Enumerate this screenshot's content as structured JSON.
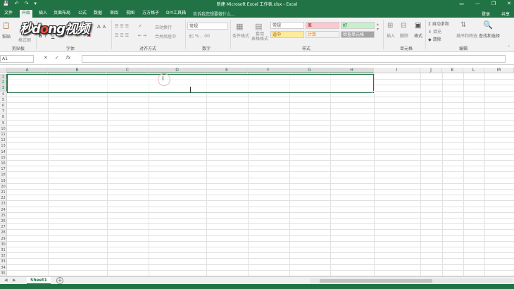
{
  "window": {
    "title": "新建 Microsoft Excel 工作表.xlsx - Excel",
    "quick_access": [
      "💾",
      "↶",
      "↷",
      "▾"
    ],
    "controls": {
      "restore": "▭",
      "minimize": "—",
      "maximize": "❐",
      "close": "✕"
    }
  },
  "tabs": [
    {
      "label": "文件"
    },
    {
      "label": "开始"
    },
    {
      "label": "插入"
    },
    {
      "label": "页面布局"
    },
    {
      "label": "公式"
    },
    {
      "label": "数据"
    },
    {
      "label": "审阅"
    },
    {
      "label": "视图"
    },
    {
      "label": "方方格子"
    },
    {
      "label": "DIY工具箱"
    }
  ],
  "tell_me": "告诉我您想要做什么...",
  "account": {
    "signin": "登录",
    "share": "共享"
  },
  "ribbon": {
    "clipboard": {
      "paste": "粘贴",
      "format_painter": "格式刷",
      "label": "剪贴板"
    },
    "font": {
      "bold": "B",
      "italic": "I",
      "underline": "U",
      "grow": "A",
      "shrink": "A",
      "label": "字体"
    },
    "alignment": {
      "wrap": "自动换行",
      "merge": "合并后居中",
      "label": "对齐方式"
    },
    "number": {
      "format": "常规",
      "label": "数字"
    },
    "styles": {
      "conditional": "条件格式",
      "table": "套用\n表格格式",
      "boxes": [
        "常规",
        "差",
        "好",
        "适中",
        "计算",
        "检查单元格"
      ],
      "label": "样式"
    },
    "cells": {
      "insert": "插入",
      "delete": "删除",
      "format": "格式",
      "label": "单元格"
    },
    "editing": {
      "autosum": "自动求和",
      "fill": "填充",
      "clear": "清除",
      "sort": "排序和筛选",
      "find": "查找和选择",
      "label": "编辑"
    },
    "watermark": "秒dong视频"
  },
  "formula_bar": {
    "name_box": "A1",
    "cancel": "✕",
    "enter": "✓",
    "fx": "fx",
    "value": ""
  },
  "columns": [
    "A",
    "B",
    "C",
    "D",
    "E",
    "F",
    "G",
    "H",
    "I",
    "J",
    "K",
    "L",
    "M"
  ],
  "rows": [
    "1",
    "2",
    "3",
    "4",
    "5",
    "6",
    "7",
    "8",
    "9",
    "10",
    "11",
    "12",
    "13",
    "14",
    "15",
    "16",
    "17",
    "18",
    "19",
    "20",
    "21",
    "22",
    "23",
    "24",
    "25",
    "26",
    "27",
    "28",
    "29",
    "30",
    "31",
    "32",
    "33",
    "34",
    "35"
  ],
  "sheets": [
    {
      "label": "Sheet1",
      "active": true
    }
  ],
  "sheet_nav": [
    "◀",
    "▶"
  ],
  "add_sheet": "+",
  "colors": {
    "accent": "#217346",
    "ribbon_bg": "#f1f1f1"
  }
}
